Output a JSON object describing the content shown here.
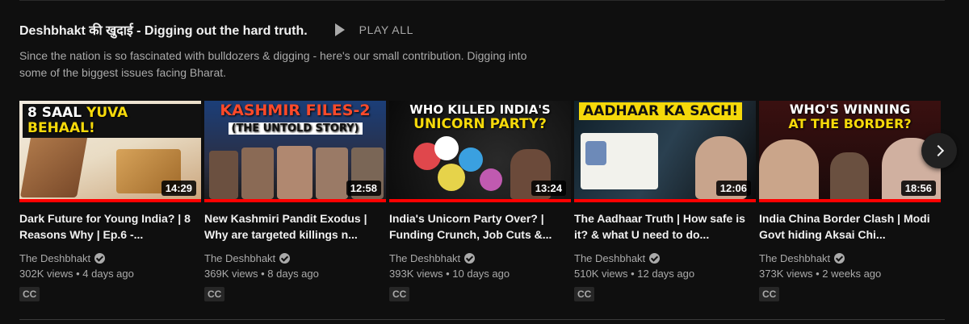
{
  "shelf": {
    "title": "Deshbhakt की खुदाई - Digging out the hard truth.",
    "play_all_label": "PLAY ALL",
    "description": "Since the nation is so fascinated with bulldozers & digging - here's our small contribution. Digging into some of the biggest issues facing Bharat."
  },
  "videos": [
    {
      "thumb_text_a": "8 SAAL ",
      "thumb_text_b": "YUVA BEHAAL!",
      "duration": "14:29",
      "title": "Dark Future for Young India? | 8 Reasons Why | Ep.6 -...",
      "channel": "The Deshbhakt",
      "views": "302K views",
      "age": "4 days ago",
      "badge": "CC",
      "watched_fraction": 1.0
    },
    {
      "thumb_text_a": "KASHMIR FILES-2",
      "thumb_text_b": "(THE UNTOLD STORY)",
      "duration": "12:58",
      "title": "New Kashmiri Pandit Exodus | Why are targeted killings n...",
      "channel": "The Deshbhakt",
      "views": "369K views",
      "age": "8 days ago",
      "badge": "CC",
      "watched_fraction": 1.0
    },
    {
      "thumb_text_a": "WHO KILLED INDIA'S",
      "thumb_text_b": "UNICORN PARTY?",
      "duration": "13:24",
      "title": "India's Unicorn Party Over? | Funding Crunch, Job Cuts &...",
      "channel": "The Deshbhakt",
      "views": "393K views",
      "age": "10 days ago",
      "badge": "CC",
      "watched_fraction": 1.0
    },
    {
      "thumb_text_a": "AADHAAR KA SACH!",
      "thumb_text_b": "",
      "duration": "12:06",
      "title": "The Aadhaar Truth | How safe is it? & what U need to do...",
      "channel": "The Deshbhakt",
      "views": "510K views",
      "age": "12 days ago",
      "badge": "CC",
      "watched_fraction": 1.0
    },
    {
      "thumb_text_a": "WHO'S WINNING",
      "thumb_text_b": "AT THE BORDER?",
      "duration": "18:56",
      "title": "India China Border Clash | Modi Govt hiding Aksai Chi...",
      "channel": "The Deshbhakt",
      "views": "373K views",
      "age": "2 weeks ago",
      "badge": "CC",
      "watched_fraction": 1.0
    }
  ],
  "colors": {
    "background": "#0f0f0f",
    "progress": "#ff0000",
    "secondary_text": "#aaaaaa"
  },
  "icons": {
    "play_all": "play-icon",
    "verified": "verified-check-icon",
    "next": "chevron-right-icon"
  }
}
